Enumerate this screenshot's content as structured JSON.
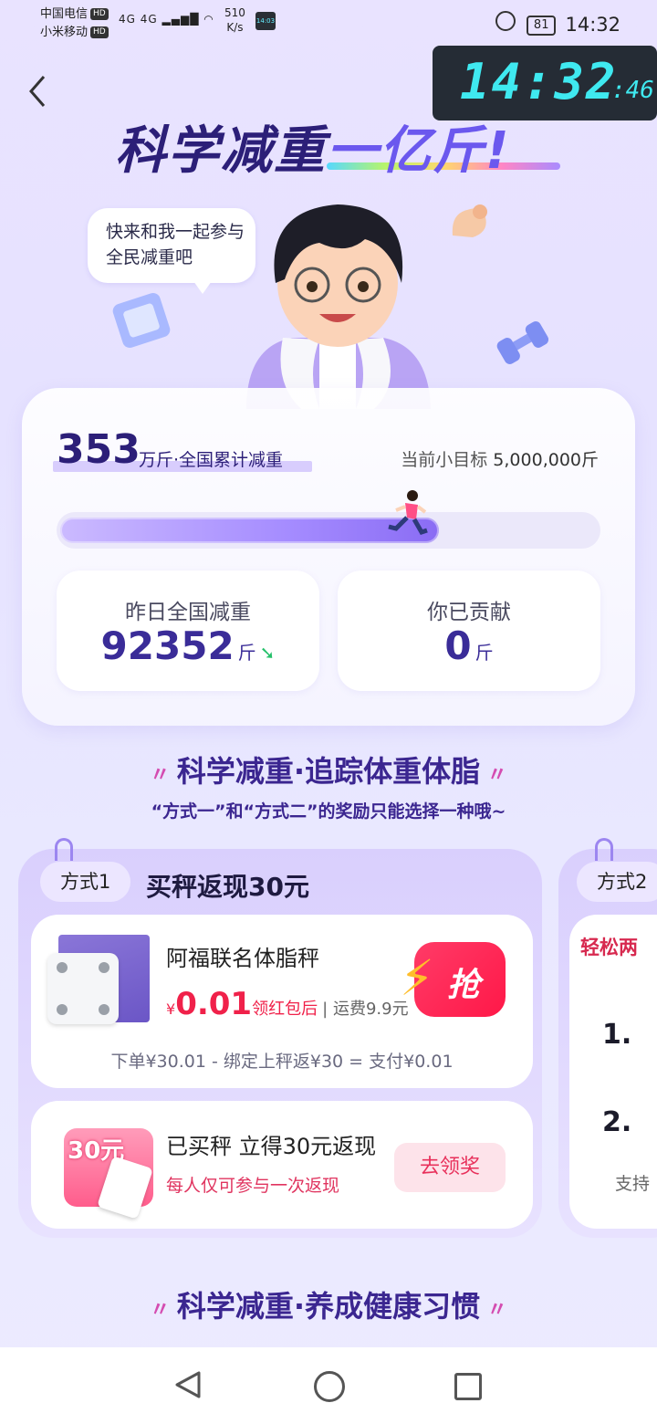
{
  "status_bar": {
    "carrier1": "中国电信",
    "carrier2": "小米移动",
    "hd": "HD",
    "signal": "4G 4G",
    "net_speed": "510",
    "net_unit": "K/s",
    "battery": "81",
    "time": "14:32"
  },
  "overlay_clock": {
    "hm": "14:32",
    "sec": ":46"
  },
  "hero": {
    "title_a": "科学减重",
    "title_b": "一亿斤!",
    "bubble_text": "快来和我一起参与全民减重吧"
  },
  "summary": {
    "total": "353",
    "total_unit": "万斤·全国累计减重",
    "goal_label": "当前小目标",
    "goal_value": "5,000,000斤",
    "progress_fraction": 0.706,
    "yesterday_label": "昨日全国减重",
    "yesterday_value": "92352",
    "unit": "斤",
    "yours_label": "你已贡献",
    "yours_value": "0"
  },
  "section1": {
    "title": "科学减重·追踪体重体脂",
    "subtitle": "“方式一”和“方式二”的奖励只能选择一种哦~"
  },
  "method1": {
    "tag": "方式1",
    "title": "买秤返现30元",
    "product_name": "阿福联名体脂秤",
    "price_symbol": "¥",
    "price": "0.01",
    "price_suffix": "领红包后",
    "shipping": "| 运费9.9元",
    "grab": "抢",
    "formula": "下单¥30.01 - 绑定上秤返¥30 = 支付¥0.01",
    "rebate_badge": "30元",
    "rebate_title": "已买秤 立得30元返现",
    "rebate_sub": "每人仅可参与一次返现",
    "rebate_button": "去领奖"
  },
  "method2": {
    "tag": "方式2",
    "header": "轻松两",
    "step1": "1.",
    "step2": "2.",
    "support": "支持"
  },
  "section2": {
    "title": "科学减重·养成健康习惯"
  }
}
